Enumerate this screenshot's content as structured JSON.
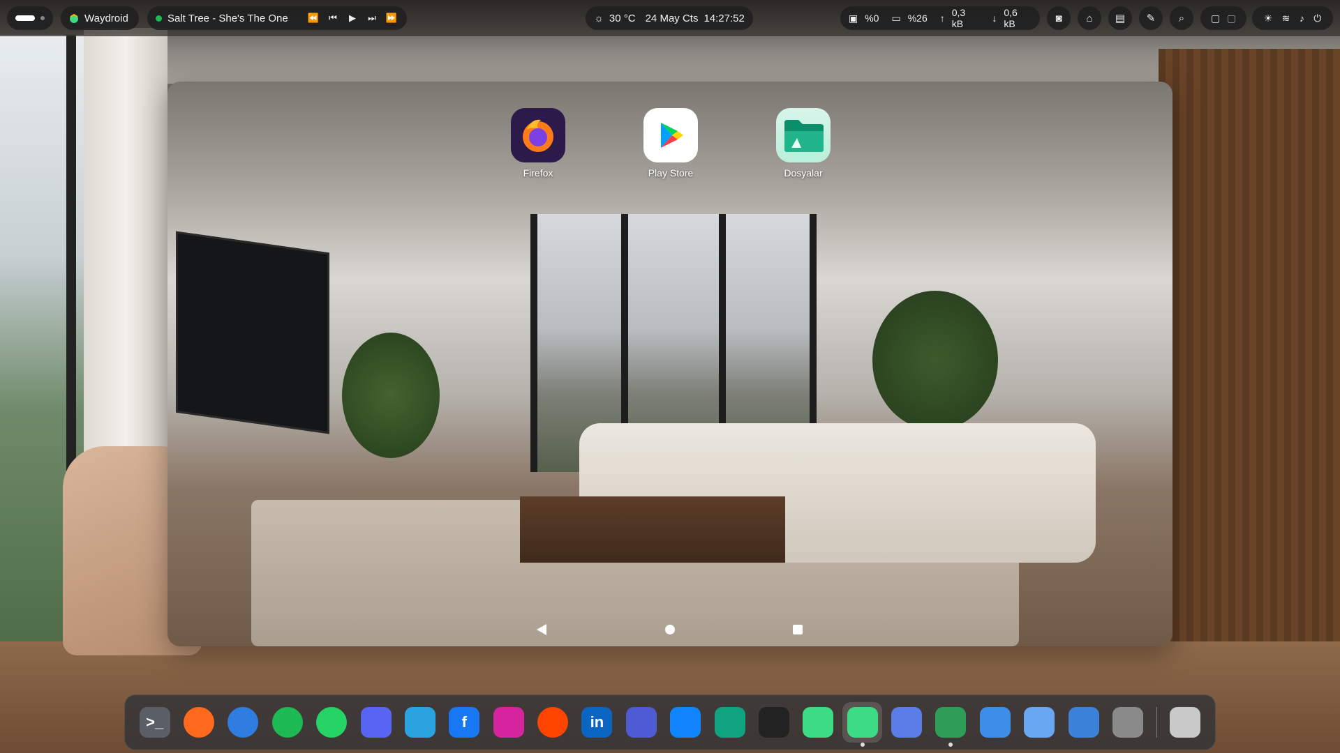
{
  "topbar": {
    "app_name": "Waydroid",
    "media": {
      "title": "Salt Tree - She's The One"
    },
    "clock": {
      "weather": "30 °C",
      "date": "24 May Cts",
      "time": "14:27:52"
    },
    "stats": {
      "cpu": "%0",
      "ram": "%26",
      "upload": "0,3 kB",
      "download": "0,6 kB"
    },
    "tray_icons": [
      "camera-icon",
      "home-icon",
      "clipboard-icon",
      "color-picker-icon",
      "search-icon",
      "keyboard-layout-icon",
      "brightness-icon",
      "wifi-icon",
      "volume-icon",
      "power-icon"
    ]
  },
  "android": {
    "apps": [
      {
        "label": "Firefox",
        "icon": "firefox-icon"
      },
      {
        "label": "Play Store",
        "icon": "play-store-icon"
      },
      {
        "label": "Dosyalar",
        "icon": "files-icon"
      }
    ],
    "nav": [
      "back-icon",
      "home-icon",
      "recents-icon"
    ]
  },
  "dock": {
    "items": [
      {
        "name": "terminal",
        "glyph": ">_",
        "color": "#5a5f66",
        "running": false
      },
      {
        "name": "firefox",
        "glyph": "",
        "color": "#ff6a1f",
        "running": false
      },
      {
        "name": "thunderbird",
        "glyph": "",
        "color": "#2f7de1",
        "running": false
      },
      {
        "name": "spotify",
        "glyph": "",
        "color": "#1db954",
        "running": false
      },
      {
        "name": "whatsapp",
        "glyph": "",
        "color": "#25d366",
        "running": false
      },
      {
        "name": "discord",
        "glyph": "",
        "color": "#5865f2",
        "running": false
      },
      {
        "name": "telegram",
        "glyph": "",
        "color": "#2aa3e0",
        "running": false
      },
      {
        "name": "facebook",
        "glyph": "f",
        "color": "#1877f2",
        "running": false
      },
      {
        "name": "instagram",
        "glyph": "",
        "color": "#d6249f",
        "running": false
      },
      {
        "name": "reddit",
        "glyph": "",
        "color": "#ff4500",
        "running": false
      },
      {
        "name": "linkedin",
        "glyph": "in",
        "color": "#0a66c2",
        "running": false
      },
      {
        "name": "authenticator",
        "glyph": "",
        "color": "#4d5bd4",
        "running": false
      },
      {
        "name": "bluesky",
        "glyph": "",
        "color": "#1185fe",
        "running": false
      },
      {
        "name": "chatgpt",
        "glyph": "",
        "color": "#10a37f",
        "running": false
      },
      {
        "name": "inkscape-cube",
        "glyph": "",
        "color": "#222222",
        "running": false
      },
      {
        "name": "android-studio",
        "glyph": "",
        "color": "#3ddc84",
        "running": false
      },
      {
        "name": "waydroid",
        "glyph": "",
        "color": "#3ddc84",
        "running": true
      },
      {
        "name": "drop-app",
        "glyph": "",
        "color": "#5a7de8",
        "running": false
      },
      {
        "name": "screen-recorder",
        "glyph": "",
        "color": "#2e9e57",
        "running": true
      },
      {
        "name": "files",
        "glyph": "",
        "color": "#3d8ee6",
        "running": false
      },
      {
        "name": "software-store",
        "glyph": "",
        "color": "#6aa7f2",
        "running": false
      },
      {
        "name": "text-editor",
        "glyph": "",
        "color": "#3b82d8",
        "running": false
      },
      {
        "name": "settings",
        "glyph": "",
        "color": "#8a8a8a",
        "running": false
      },
      {
        "name": "trash",
        "glyph": "",
        "color": "#c9c9c9",
        "running": false
      }
    ]
  }
}
